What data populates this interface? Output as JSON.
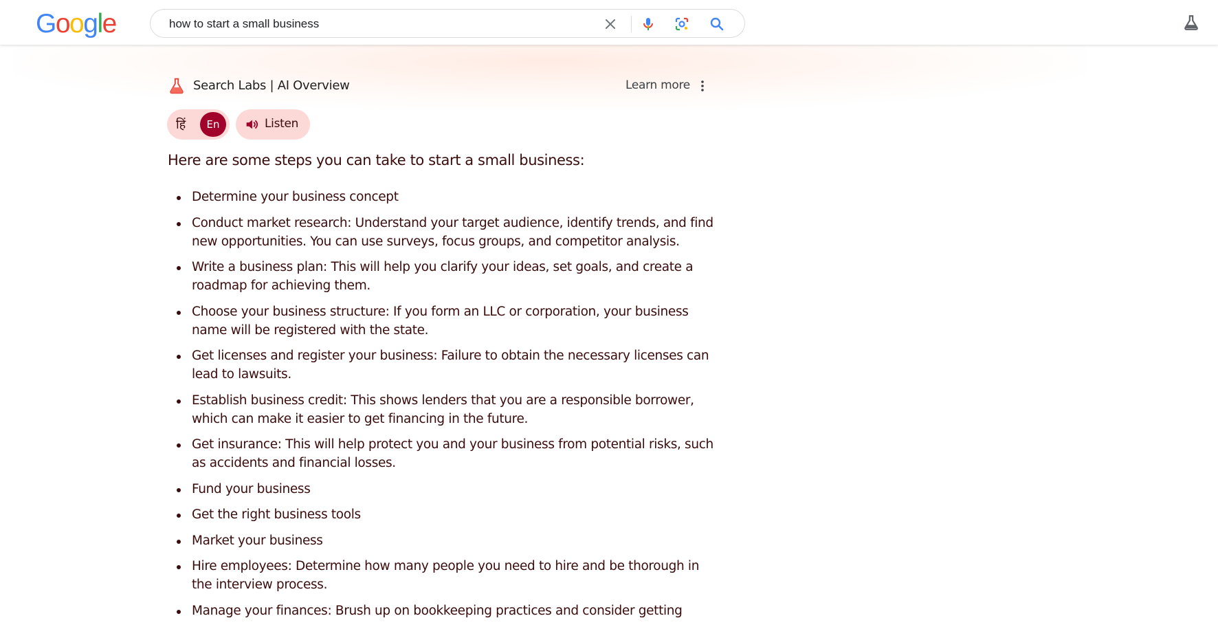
{
  "header": {
    "logo_letters": [
      {
        "char": "G",
        "color": "#4285F4"
      },
      {
        "char": "o",
        "color": "#EA4335"
      },
      {
        "char": "o",
        "color": "#FBBC05"
      },
      {
        "char": "g",
        "color": "#4285F4"
      },
      {
        "char": "l",
        "color": "#34A853"
      },
      {
        "char": "e",
        "color": "#EA4335"
      }
    ],
    "search": {
      "query": "how to start a small business",
      "icons": [
        "clear-icon",
        "mic-icon",
        "lens-icon",
        "search-icon"
      ]
    },
    "labs_icon": "labs-flask-icon"
  },
  "ai_overview": {
    "title": "Search Labs | AI Overview",
    "learn_more": "Learn more",
    "lang_hindi": "हिं",
    "lang_english": "En",
    "listen_label": "Listen",
    "intro": "Here are some steps you can take to start a small business:",
    "steps": [
      "Determine your business concept",
      "Conduct market research: Understand your target audience, identify trends, and find new opportunities. You can use surveys, focus groups, and competitor analysis.",
      "Write a business plan: This will help you clarify your ideas, set goals, and create a roadmap for achieving them.",
      "Choose your business structure: If you form an LLC or corporation, your business name will be registered with the state.",
      "Get licenses and register your business: Failure to obtain the necessary licenses can lead to lawsuits.",
      "Establish business credit: This shows lenders that you are a responsible borrower, which can make it easier to get financing in the future.",
      "Get insurance: This will help protect you and your business from potential risks, such as accidents and financial losses.",
      "Fund your business",
      "Get the right business tools",
      "Market your business",
      "Hire employees: Determine how many people you need to hire and be thorough in the interview process.",
      "Manage your finances: Brush up on bookkeeping practices and consider getting"
    ]
  },
  "colors": {
    "accent": "#a1002a",
    "pill_bg": "#fcd9d6",
    "text": "#3a0c0c"
  }
}
